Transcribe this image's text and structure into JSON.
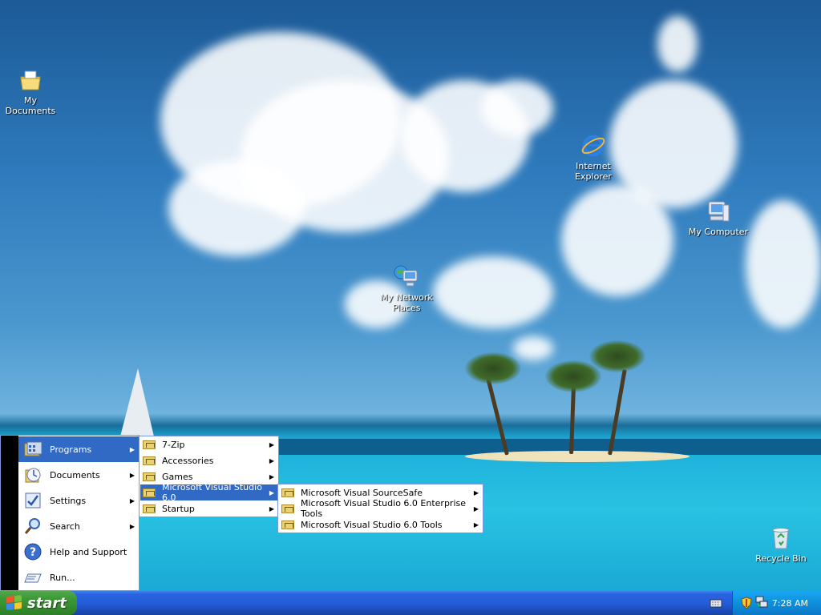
{
  "desktop": {
    "icons": [
      {
        "label": "My Documents",
        "icon": "my-documents-icon"
      },
      {
        "label": "Internet Explorer",
        "icon": "internet-explorer-icon"
      },
      {
        "label": "My Computer",
        "icon": "my-computer-icon"
      },
      {
        "label": "My Network Places",
        "icon": "network-places-icon"
      },
      {
        "label": "Recycle Bin",
        "icon": "recycle-bin-icon"
      }
    ]
  },
  "start_menu": {
    "items": [
      {
        "label": "Programs",
        "icon": "programs-icon",
        "has_submenu": true,
        "active": true
      },
      {
        "label": "Documents",
        "icon": "documents-icon",
        "has_submenu": true
      },
      {
        "label": "Settings",
        "icon": "settings-icon",
        "has_submenu": true
      },
      {
        "label": "Search",
        "icon": "search-icon",
        "has_submenu": true
      },
      {
        "label": "Help and Support",
        "icon": "help-icon",
        "has_submenu": false
      },
      {
        "label": "Run...",
        "icon": "run-icon",
        "has_submenu": false
      }
    ]
  },
  "programs_menu": {
    "items": [
      {
        "label": "7-Zip",
        "icon": "program-group-icon",
        "has_submenu": true
      },
      {
        "label": "Accessories",
        "icon": "program-group-icon",
        "has_submenu": true
      },
      {
        "label": "Games",
        "icon": "program-group-icon",
        "has_submenu": true
      },
      {
        "label": "Microsoft Visual Studio 6.0",
        "icon": "program-group-icon",
        "has_submenu": true,
        "active": true
      },
      {
        "label": "Startup",
        "icon": "program-group-icon",
        "has_submenu": true
      }
    ]
  },
  "vs_menu": {
    "items": [
      {
        "label": "Microsoft Visual SourceSafe",
        "icon": "program-group-icon",
        "has_submenu": true
      },
      {
        "label": "Microsoft Visual Studio 6.0 Enterprise Tools",
        "icon": "program-group-icon",
        "has_submenu": true
      },
      {
        "label": "Microsoft Visual Studio 6.0 Tools",
        "icon": "program-group-icon",
        "has_submenu": true
      }
    ]
  },
  "taskbar": {
    "start_label": "start",
    "clock": "7:28 AM",
    "tray_icons": [
      "keyboard-icon",
      "security-shield-icon",
      "network-icon"
    ]
  },
  "colors": {
    "taskbar_blue": "#245edb",
    "start_green": "#3d9a37",
    "menu_highlight": "#316ac5",
    "tray_blue": "#0f8fdb"
  }
}
